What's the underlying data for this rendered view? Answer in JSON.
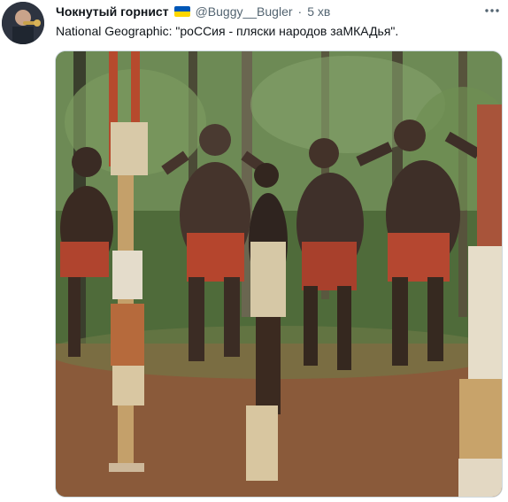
{
  "tweet": {
    "author_name": "Чокнутый горнист",
    "handle": "@Buggy__Bugler",
    "separator": "·",
    "time": "5 хв",
    "text": "National Geographic: \"роССия - пляски народов заМКАДья\".",
    "flag_colors": [
      "#0057b7",
      "#ffd700"
    ],
    "more_icon": "more-horizontal-icon",
    "media_description_icon": "video-photo"
  }
}
